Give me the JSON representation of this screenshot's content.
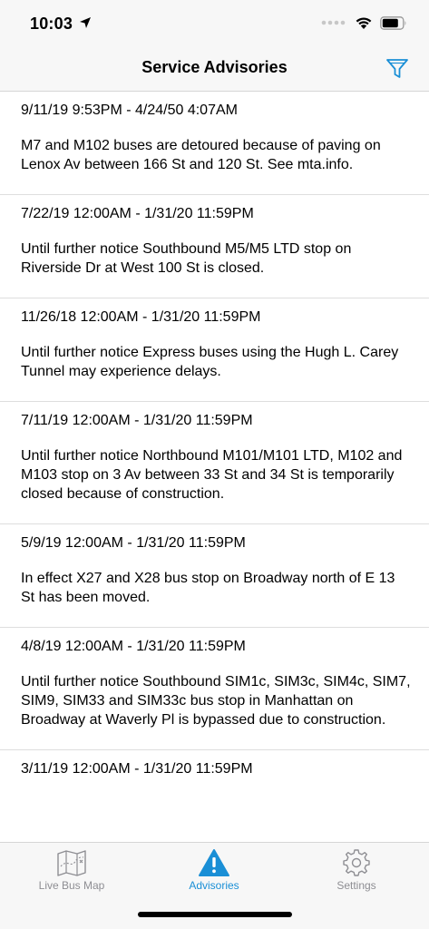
{
  "status": {
    "time": "10:03"
  },
  "nav": {
    "title": "Service Advisories"
  },
  "advisories": [
    {
      "dates": "9/11/19 9:53PM - 4/24/50 4:07AM",
      "text": "M7 and M102 buses are detoured because of paving on Lenox Av between 166 St and 120 St. See mta.info."
    },
    {
      "dates": "7/22/19 12:00AM - 1/31/20 11:59PM",
      "text": "Until further notice Southbound M5/M5 LTD stop on Riverside Dr at West 100 St is closed."
    },
    {
      "dates": "11/26/18 12:00AM - 1/31/20 11:59PM",
      "text": "Until further notice Express buses using the Hugh L. Carey Tunnel may experience delays."
    },
    {
      "dates": "7/11/19 12:00AM - 1/31/20 11:59PM",
      "text": "Until further notice Northbound M101/M101 LTD, M102 and M103 stop on 3 Av between 33 St and 34 St is temporarily closed because of construction."
    },
    {
      "dates": "5/9/19 12:00AM - 1/31/20 11:59PM",
      "text": "In effect X27 and X28 bus stop on Broadway north of E 13 St has been moved."
    },
    {
      "dates": "4/8/19 12:00AM - 1/31/20 11:59PM",
      "text": "Until further notice Southbound SIM1c, SIM3c, SIM4c, SIM7, SIM9, SIM33 and SIM33c bus stop in Manhattan on Broadway at Waverly Pl is bypassed due to construction."
    },
    {
      "dates": "3/11/19 12:00AM - 1/31/20 11:59PM",
      "text": ""
    }
  ],
  "tabs": [
    {
      "label": "Live Bus Map",
      "icon": "map-icon"
    },
    {
      "label": "Advisories",
      "icon": "warning-icon",
      "active": true
    },
    {
      "label": "Settings",
      "icon": "gear-icon"
    }
  ],
  "colors": {
    "accent": "#1a8fd6",
    "inactive": "#8e8e93"
  }
}
